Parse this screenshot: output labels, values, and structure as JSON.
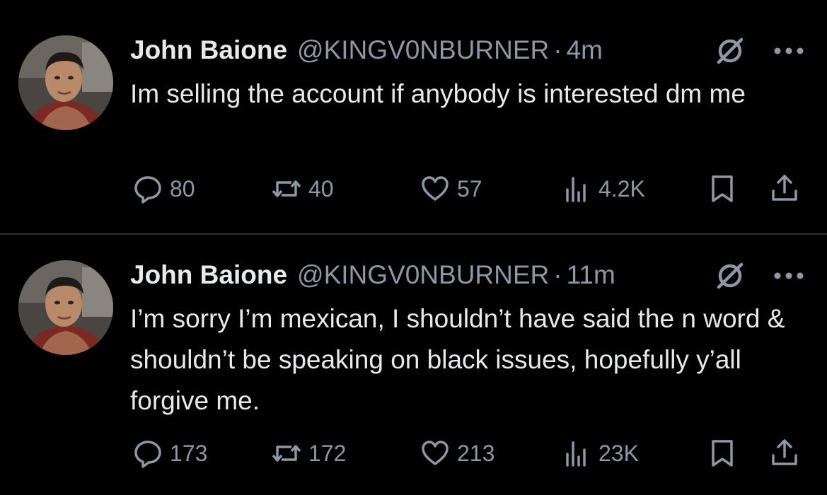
{
  "colors": {
    "background": "#000000",
    "primary_text": "#e7e9ea",
    "secondary_text": "#8b98a5",
    "divider": "#2f3336"
  },
  "tweets": [
    {
      "author_name": "John Baione",
      "handle": "@KINGV0NBURNER",
      "separator": "·",
      "time": "4m",
      "text": "Im selling the account if anybody is interested dm me",
      "icons": {
        "status": "blocked-circle-icon",
        "more": "more-dots-icon"
      },
      "actions": {
        "replies": "80",
        "reposts": "40",
        "likes": "57",
        "views": "4.2K"
      }
    },
    {
      "author_name": "John Baione",
      "handle": "@KINGV0NBURNER",
      "separator": "·",
      "time": "11m",
      "text": "I’m sorry I’m mexican, I shouldn’t have said the n word & shouldn’t be speaking on black issues, hopefully y’all forgive me.",
      "icons": {
        "status": "blocked-circle-icon",
        "more": "more-dots-icon"
      },
      "actions": {
        "replies": "173",
        "reposts": "172",
        "likes": "213",
        "views": "23K"
      }
    }
  ]
}
